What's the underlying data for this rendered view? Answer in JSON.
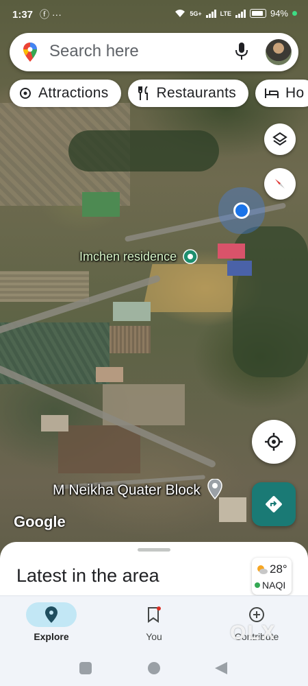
{
  "status_bar": {
    "time": "1:37",
    "left_icons": "ⓕ ···",
    "network_1": "5G+",
    "network_2": "LTE",
    "battery": "94%"
  },
  "search": {
    "placeholder": "Search here"
  },
  "chips": [
    {
      "label": "Attractions",
      "icon": "attractions-icon"
    },
    {
      "label": "Restaurants",
      "icon": "restaurant-icon"
    },
    {
      "label": "Ho",
      "icon": "hotel-icon"
    }
  ],
  "map": {
    "place_1": "Imchen residence",
    "place_2": "M Neikha Quater Block",
    "logo": "Google"
  },
  "sheet": {
    "title": "Latest in the area",
    "weather_temp": "28°",
    "aqi": "NAQI"
  },
  "bottom_nav": [
    {
      "label": "Explore",
      "active": true
    },
    {
      "label": "You",
      "active": false
    },
    {
      "label": "Contribute",
      "active": false
    }
  ],
  "watermark": "OLX",
  "colors": {
    "accent": "#1a73e8",
    "directions": "#1a7a75",
    "nav_active": "#c2e7f5"
  }
}
